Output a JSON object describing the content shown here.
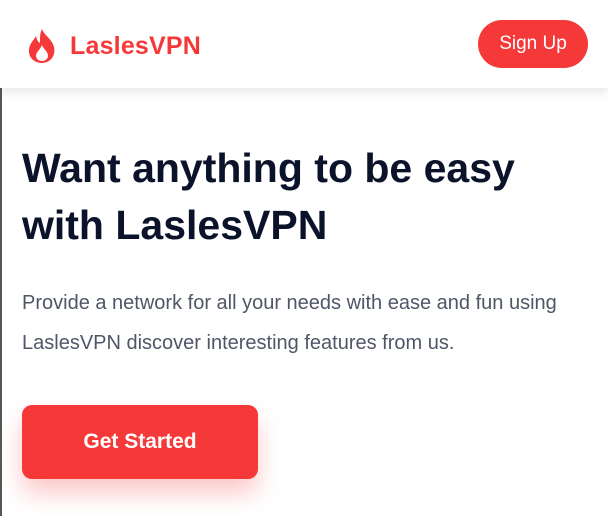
{
  "navbar": {
    "brand_name": "LaslesVPN",
    "logo_icon": "flame-logo-icon",
    "signup_label": "Sign Up"
  },
  "hero": {
    "title": "Want anything to be easy with LaslesVPN",
    "description": "Provide a network for all your needs with ease and fun using LaslesVPN discover interesting features from us.",
    "cta_label": "Get Started"
  },
  "colors": {
    "brand_red": "#F53838",
    "heading": "#0B132A",
    "body_text": "#4F5665",
    "background": "#FFFFFF"
  }
}
